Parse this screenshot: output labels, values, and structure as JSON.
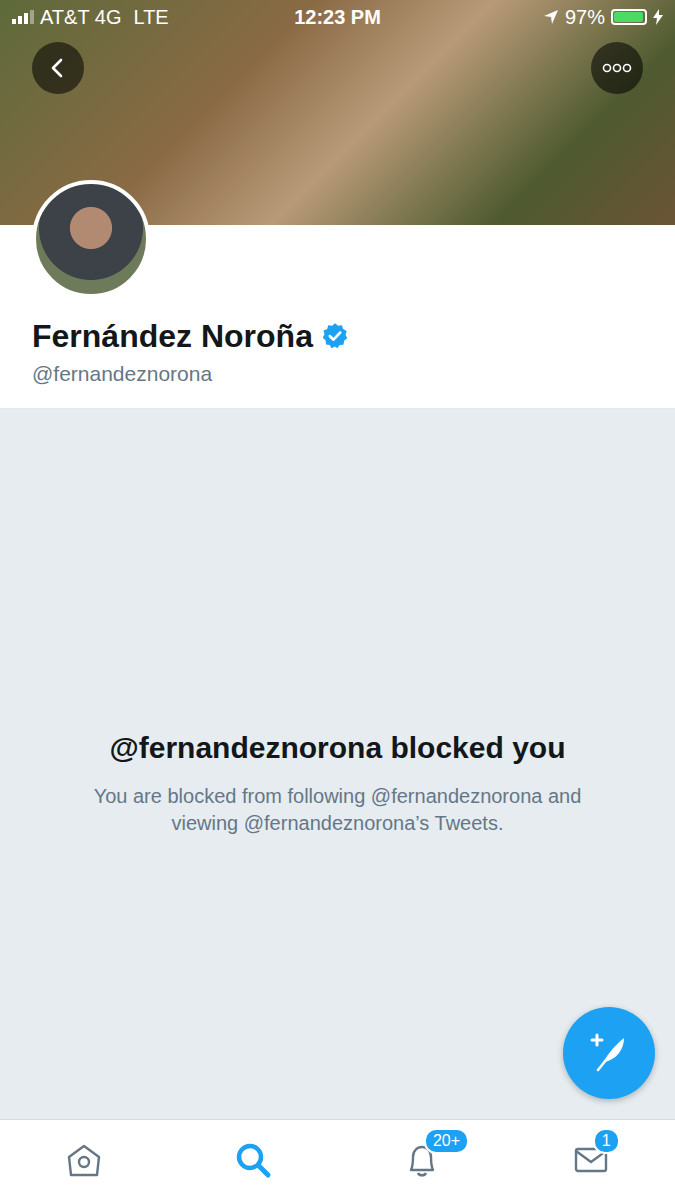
{
  "status_bar": {
    "carrier": "AT&T 4G",
    "network": "LTE",
    "time": "12:23 PM",
    "battery": "97%",
    "battery_level": 0.97,
    "charging": true
  },
  "profile": {
    "name": "Fernández Noroña",
    "verified": true,
    "handle": "@fernandeznorona"
  },
  "blocked": {
    "title": "@fernandeznorona blocked you",
    "message": "You are blocked from following @fernandeznorona and viewing @fernandeznorona’s Tweets."
  },
  "tabs": [
    {
      "kind": "home",
      "selected": false,
      "badge": null
    },
    {
      "kind": "search",
      "selected": true,
      "badge": null
    },
    {
      "kind": "notifications",
      "selected": false,
      "badge": "20+"
    },
    {
      "kind": "messages",
      "selected": false,
      "badge": "1"
    }
  ]
}
